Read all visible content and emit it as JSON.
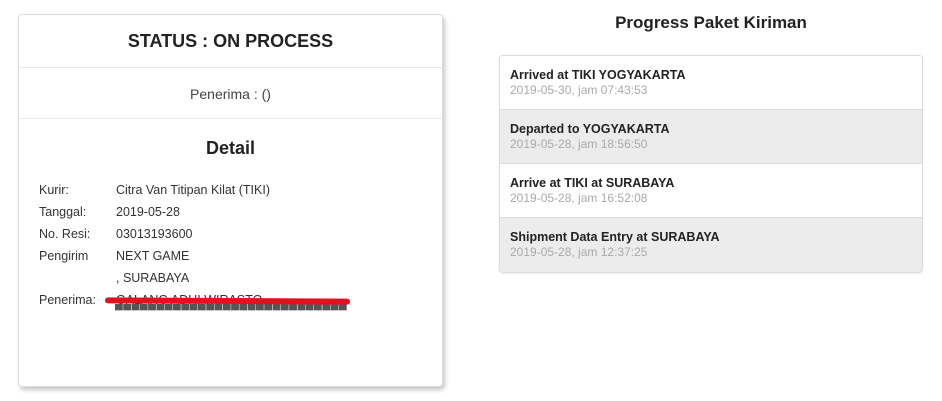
{
  "status": {
    "title": "STATUS : ON PROCESS",
    "recipient_line": "Penerima : ()"
  },
  "detail": {
    "heading": "Detail",
    "rows": [
      {
        "label": "Kurir:",
        "value": "Citra Van Titipan Kilat (TIKI)"
      },
      {
        "label": "Tanggal:",
        "value": "2019-05-28"
      },
      {
        "label": "No. Resi:",
        "value": "03013193600"
      },
      {
        "label": "Pengirim",
        "value": "NEXT GAME"
      },
      {
        "label": "",
        "value": ", SURABAYA"
      },
      {
        "label": "Penerima:",
        "value": "GALANG ADHI WIRASTO"
      }
    ],
    "redaction_color": "#e3101d"
  },
  "progress": {
    "title": "Progress Paket Kiriman",
    "items": [
      {
        "event": "Arrived at TIKI YOGYAKARTA",
        "time": "2019-05-30, jam 07:43:53"
      },
      {
        "event": "Departed to YOGYAKARTA",
        "time": "2019-05-28, jam 18:56:50"
      },
      {
        "event": "Arrive at TIKI at SURABAYA",
        "time": "2019-05-28, jam 16:52:08"
      },
      {
        "event": "Shipment Data Entry at SURABAYA",
        "time": "2019-05-28, jam 12:37:25"
      }
    ]
  }
}
